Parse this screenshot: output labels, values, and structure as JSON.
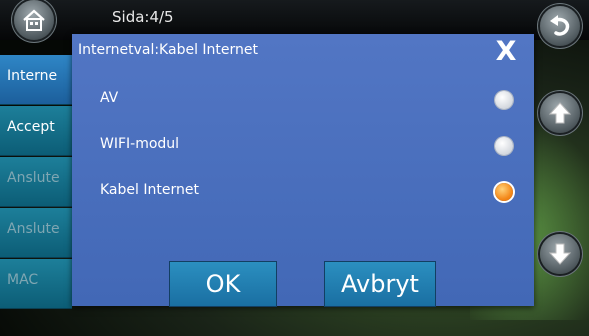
{
  "topbar": {
    "page_indicator": "Sida:4/5"
  },
  "menu": {
    "items": [
      {
        "label": "Interne",
        "state": "selected"
      },
      {
        "label": "Accept",
        "state": "normal"
      },
      {
        "label": "Anslute",
        "state": "dim"
      },
      {
        "label": "Anslute",
        "state": "dim"
      },
      {
        "label": "MAC",
        "state": "dim"
      }
    ]
  },
  "dialog": {
    "title": "Internetval:Kabel Internet",
    "close_label": "X",
    "options": [
      {
        "label": "AV",
        "checked": false
      },
      {
        "label": "WIFI-modul",
        "checked": false
      },
      {
        "label": "Kabel Internet",
        "checked": true
      }
    ],
    "ok_label": "OK",
    "cancel_label": "Avbryt"
  },
  "icons": {
    "home": "home-icon",
    "back": "back-arrow-icon",
    "up": "arrow-up-icon",
    "down": "arrow-down-icon"
  },
  "colors": {
    "dialog_bg": "#4a6fbd",
    "button_bg": "#2283b6",
    "menu_bg": "#166f8a",
    "radio_selected": "#f48a1c"
  }
}
